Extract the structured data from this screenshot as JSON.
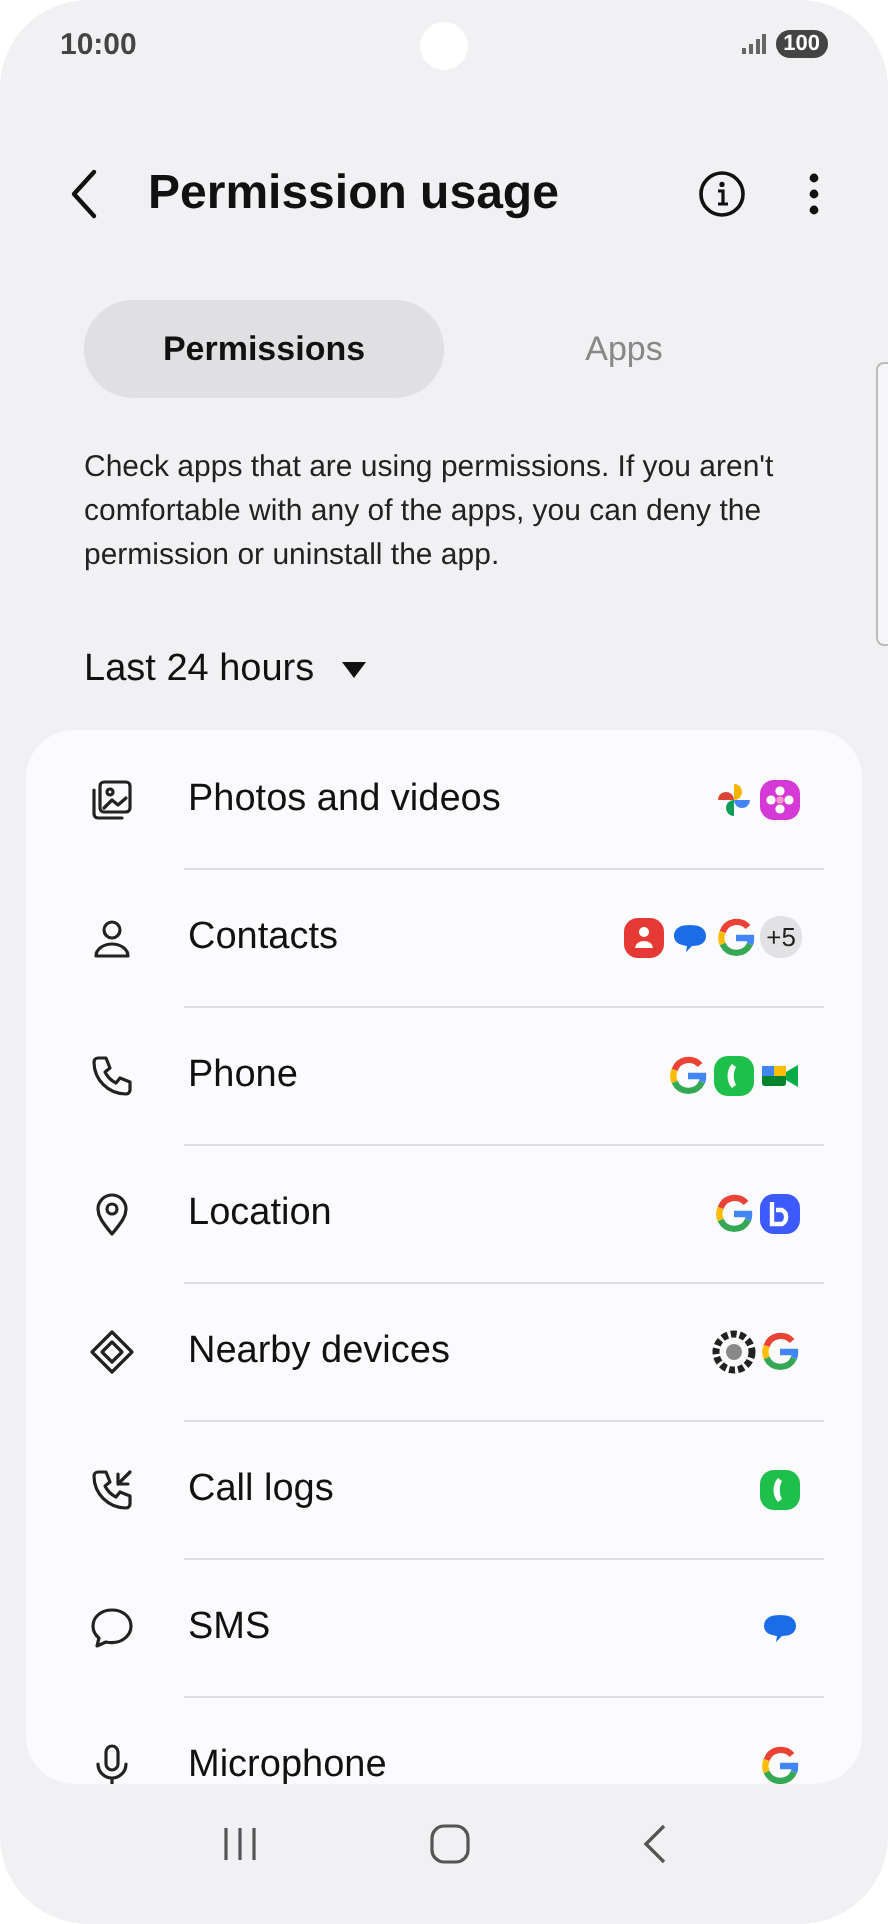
{
  "status_bar": {
    "time": "10:00",
    "battery": "100"
  },
  "header": {
    "title": "Permission usage"
  },
  "tabs": [
    {
      "label": "Permissions",
      "selected": true
    },
    {
      "label": "Apps",
      "selected": false
    }
  ],
  "description": "Check apps that are using permissions. If you aren't comfortable with any of the apps, you can deny the permission or uninstall the app.",
  "period": {
    "label": "Last 24 hours"
  },
  "permissions": [
    {
      "kind": "photos",
      "label": "Photos and videos",
      "apps": [
        {
          "kind": "pinwheel"
        },
        {
          "kind": "flower"
        }
      ]
    },
    {
      "kind": "contacts",
      "label": "Contacts",
      "apps": [
        {
          "kind": "contacts"
        },
        {
          "kind": "messages"
        },
        {
          "kind": "google"
        },
        {
          "kind": "more",
          "label": "+5"
        }
      ]
    },
    {
      "kind": "phone",
      "label": "Phone",
      "apps": [
        {
          "kind": "google"
        },
        {
          "kind": "phone"
        },
        {
          "kind": "video"
        }
      ]
    },
    {
      "kind": "location",
      "label": "Location",
      "apps": [
        {
          "kind": "google"
        },
        {
          "kind": "bixby"
        }
      ]
    },
    {
      "kind": "nearby",
      "label": "Nearby devices",
      "apps": [
        {
          "kind": "gear"
        },
        {
          "kind": "google"
        }
      ]
    },
    {
      "kind": "call_logs",
      "label": "Call logs",
      "apps": [
        {
          "kind": "phone"
        }
      ]
    },
    {
      "kind": "sms",
      "label": "SMS",
      "apps": [
        {
          "kind": "messages"
        }
      ]
    },
    {
      "kind": "microphone",
      "label": "Microphone",
      "apps": [
        {
          "kind": "google"
        }
      ]
    }
  ]
}
